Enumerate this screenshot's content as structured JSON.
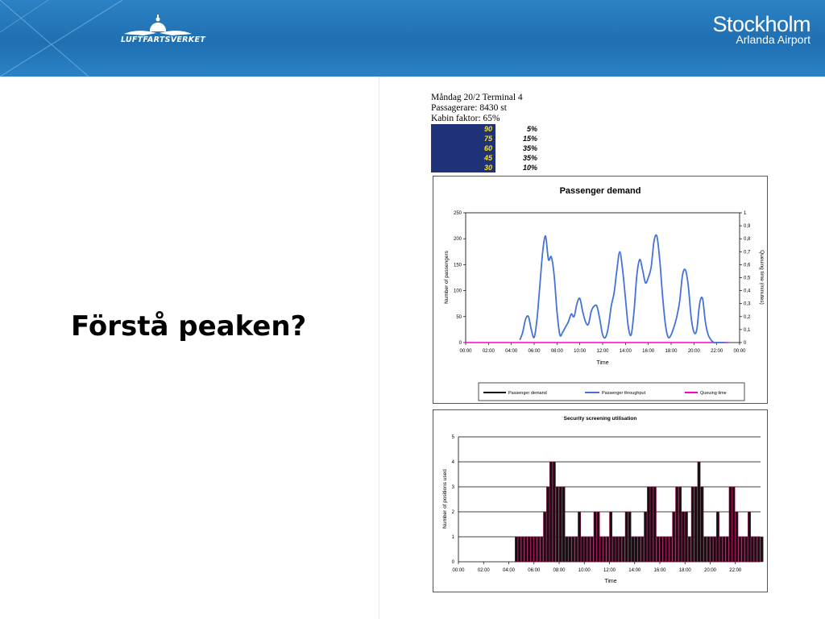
{
  "header": {
    "left_logo_text": "LUFTFARTSVERKET",
    "right_logo_main": "Stockholm",
    "right_logo_sub": "Arlanda Airport"
  },
  "slide_title": "Förstå peaken?",
  "info": {
    "line1": "Måndag 20/2 Terminal 4",
    "line2": "Passagerare: 8430 st",
    "line3": "Kabin faktor: 65%"
  },
  "mix_table": [
    {
      "value": "90",
      "pct": "5%"
    },
    {
      "value": "75",
      "pct": "15%"
    },
    {
      "value": "60",
      "pct": "35%"
    },
    {
      "value": "45",
      "pct": "35%"
    },
    {
      "value": "30",
      "pct": "10%"
    }
  ],
  "colors": {
    "header": "#1f6fb1",
    "table_bg": "#1f3278",
    "table_text": "#ffe600",
    "demand": "#000000",
    "throughput": "#4472d8",
    "queuing": "#ff00cc",
    "bar_edge": "#a8004c"
  },
  "chart_data": [
    {
      "type": "line",
      "title": "Passenger demand",
      "xlabel": "Time",
      "ylabel": "Number of passengers",
      "y2label": "Queuing time (minutes)",
      "x_ticks": [
        "00:00",
        "02:00",
        "04:00",
        "06:00",
        "08:00",
        "10:00",
        "12:00",
        "14:00",
        "16:00",
        "18:00",
        "20:00",
        "22:00",
        "00:00"
      ],
      "y_ticks": [
        "0",
        "50",
        "100",
        "150",
        "200",
        "250"
      ],
      "y2_ticks": [
        "0",
        "0,1",
        "0,2",
        "0,3",
        "0,4",
        "0,5",
        "0,6",
        "0,7",
        "0,8",
        "0,9",
        "1"
      ],
      "ylim": [
        0,
        250
      ],
      "y2lim": [
        0,
        1
      ],
      "xlim_hours": [
        0,
        24
      ],
      "grid": false,
      "legend_position": "bottom",
      "series": [
        {
          "name": "Passenger demand",
          "color": "#000000",
          "x": [],
          "values": []
        },
        {
          "name": "Passenger throughput",
          "color": "#4472d8",
          "x": [
            4.75,
            5.0,
            5.25,
            5.5,
            5.75,
            6.0,
            6.25,
            6.5,
            6.75,
            7.0,
            7.25,
            7.5,
            7.75,
            8.0,
            8.25,
            8.5,
            8.75,
            9.0,
            9.25,
            9.5,
            9.75,
            10.0,
            10.25,
            10.5,
            10.75,
            11.0,
            11.25,
            11.5,
            11.75,
            12.0,
            12.25,
            12.5,
            12.75,
            13.0,
            13.25,
            13.5,
            13.75,
            14.0,
            14.25,
            14.5,
            14.75,
            15.0,
            15.25,
            15.5,
            15.75,
            16.0,
            16.25,
            16.5,
            16.75,
            17.0,
            17.25,
            17.5,
            17.75,
            18.0,
            18.25,
            18.5,
            18.75,
            19.0,
            19.25,
            19.5,
            19.75,
            20.0,
            20.25,
            20.5,
            20.75,
            21.0,
            21.25,
            21.5,
            21.75,
            22.0,
            22.25,
            22.5,
            22.75
          ],
          "values": [
            5,
            20,
            45,
            50,
            25,
            10,
            45,
            110,
            175,
            205,
            160,
            165,
            130,
            60,
            15,
            20,
            30,
            40,
            55,
            50,
            75,
            85,
            60,
            40,
            35,
            60,
            70,
            70,
            45,
            15,
            10,
            30,
            70,
            95,
            140,
            175,
            140,
            85,
            30,
            15,
            60,
            130,
            160,
            140,
            115,
            125,
            145,
            195,
            205,
            160,
            90,
            35,
            10,
            15,
            30,
            50,
            80,
            130,
            140,
            110,
            50,
            20,
            25,
            75,
            85,
            40,
            15,
            5,
            0,
            0,
            0,
            0,
            0
          ]
        },
        {
          "name": "Queuing time",
          "color": "#ff00cc",
          "axis": "right",
          "x": [
            0,
            23
          ],
          "values": [
            0,
            0
          ]
        }
      ]
    },
    {
      "type": "bar",
      "title": "Security screening utilisation",
      "xlabel": "Time",
      "ylabel": "Number of positions used",
      "x_ticks": [
        "00:00",
        "02:00",
        "04:00",
        "06:00",
        "08:00",
        "10:00",
        "12:00",
        "14:00",
        "16:00",
        "18:00",
        "20:00",
        "22:00"
      ],
      "y_ticks": [
        "0",
        "1",
        "2",
        "3",
        "4",
        "5"
      ],
      "ylim": [
        0,
        5
      ],
      "xlim_hours": [
        0,
        24
      ],
      "grid": true,
      "bin_minutes": 15,
      "x_start_hour": 4.5,
      "values": [
        1,
        1,
        1,
        1,
        1,
        1,
        1,
        1,
        1,
        2,
        3,
        4,
        4,
        3,
        3,
        3,
        1,
        1,
        1,
        1,
        2,
        1,
        1,
        1,
        1,
        2,
        2,
        1,
        1,
        1,
        2,
        1,
        1,
        1,
        1,
        2,
        2,
        1,
        1,
        1,
        1,
        2,
        3,
        3,
        3,
        1,
        1,
        1,
        1,
        1,
        2,
        3,
        3,
        2,
        2,
        1,
        3,
        3,
        4,
        3,
        1,
        1,
        1,
        1,
        2,
        1,
        1,
        1,
        3,
        3,
        2,
        1,
        1,
        1,
        2,
        1,
        1,
        1,
        1,
        0,
        0,
        0,
        0,
        0,
        0,
        0,
        0,
        0,
        0,
        0,
        0,
        0,
        0,
        0,
        0,
        0,
        0,
        0,
        0,
        0,
        0
      ]
    }
  ]
}
